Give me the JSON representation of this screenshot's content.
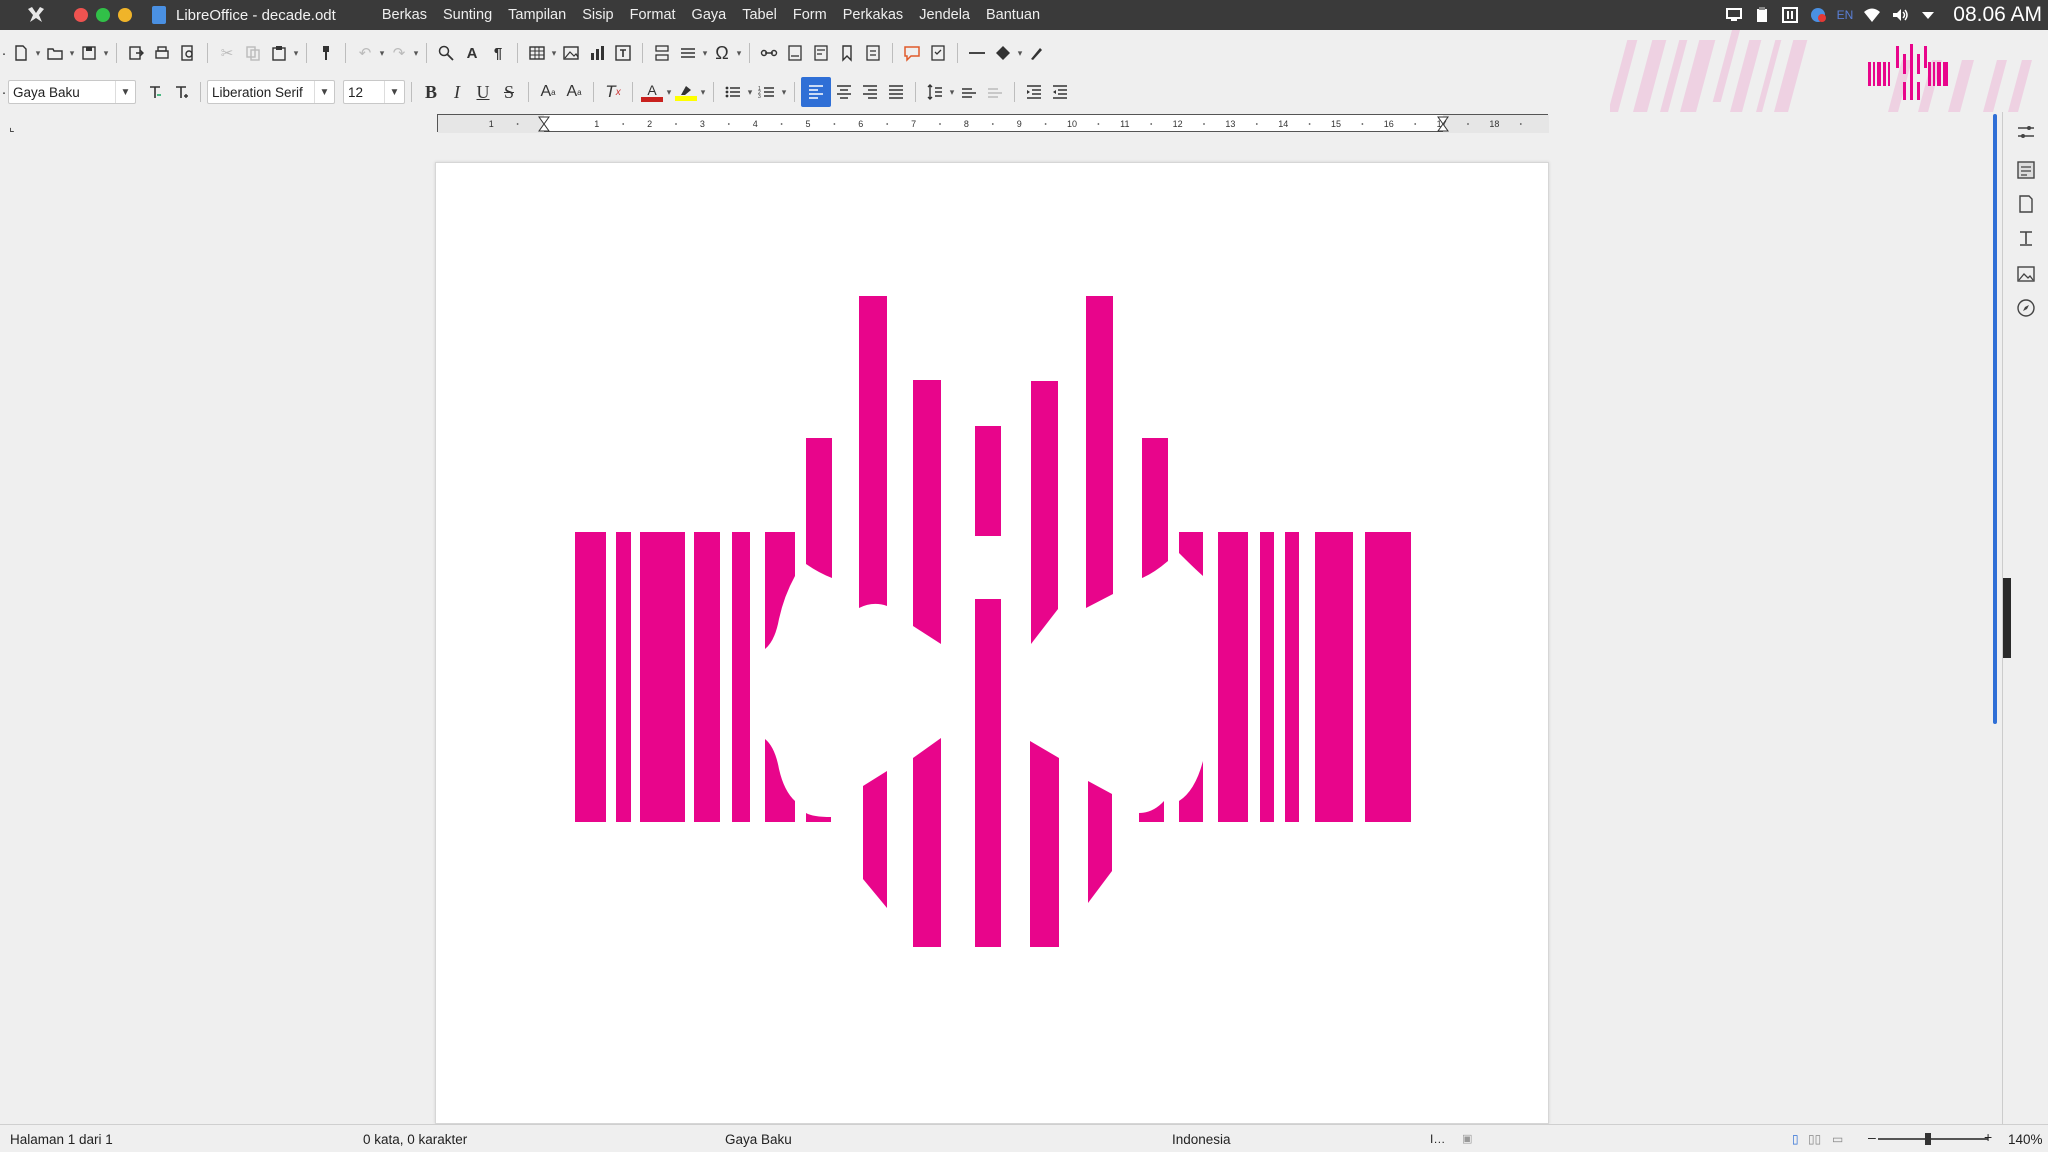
{
  "app": {
    "window_title": "LibreOffice - decade.odt",
    "menu": [
      "Berkas",
      "Sunting",
      "Tampilan",
      "Sisip",
      "Format",
      "Gaya",
      "Tabel",
      "Form",
      "Perkakas",
      "Jendela",
      "Bantuan"
    ],
    "clock": "08.06 AM",
    "tray_lang": "EN"
  },
  "formatting": {
    "paragraph_style": "Gaya Baku",
    "font_name": "Liberation Serif",
    "font_size": "12",
    "active_alignment": "align-left",
    "font_color_swatch": "#c9211e",
    "highlight_swatch": "#ffff00"
  },
  "ruler": {
    "ticks": [
      "1",
      "1",
      "2",
      "3",
      "4",
      "5",
      "6",
      "7",
      "8",
      "9",
      "10",
      "11",
      "12",
      "13",
      "14",
      "15",
      "16",
      "17",
      "18"
    ]
  },
  "document": {
    "artwork_color": "#e8058b"
  },
  "statusbar": {
    "page": "Halaman 1 dari 1",
    "words": "0 kata, 0 karakter",
    "style": "Gaya Baku",
    "language": "Indonesia",
    "zoom": "140%"
  }
}
